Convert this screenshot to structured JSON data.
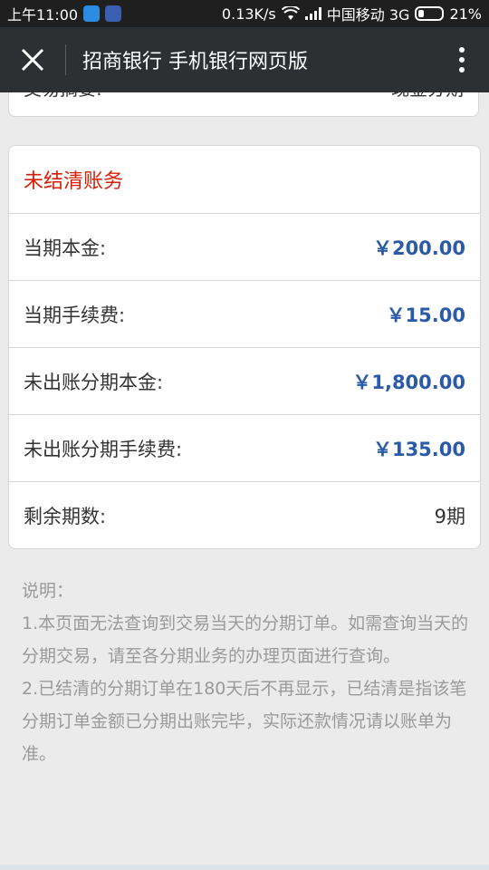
{
  "status_bar": {
    "time": "上午11:00",
    "network_speed": "0.13K/s",
    "carrier": "中国移动 3G",
    "battery": "21%"
  },
  "app_bar": {
    "title": "招商银行 手机银行网页版",
    "close_icon": "close-icon",
    "menu_icon": "more-vertical-icon"
  },
  "previous_card": {
    "label": "交易摘要:",
    "value": "现金分期"
  },
  "unsettled": {
    "title": "未结清账务",
    "rows": [
      {
        "label": "当期本金:",
        "value": "￥200.00"
      },
      {
        "label": "当期手续费:",
        "value": "￥15.00"
      },
      {
        "label": "未出账分期本金:",
        "value": "￥1,800.00"
      },
      {
        "label": "未出账分期手续费:",
        "value": "￥135.00"
      },
      {
        "label": "剩余期数:",
        "value": "9期"
      }
    ]
  },
  "notes": {
    "heading": "说明：",
    "items": [
      "1.本页面无法查询到交易当天的分期订单。如需查询当天的分期交易，请至各分期业务的办理页面进行查询。",
      "2.已结清的分期订单在180天后不再显示，已结清是指该笔分期订单金额已分期出账完毕，实际还款情况请以账单为准。"
    ]
  },
  "colors": {
    "accent_red": "#d81e06",
    "amount_blue": "#2a5aa8",
    "app_bar": "#2d3032"
  }
}
